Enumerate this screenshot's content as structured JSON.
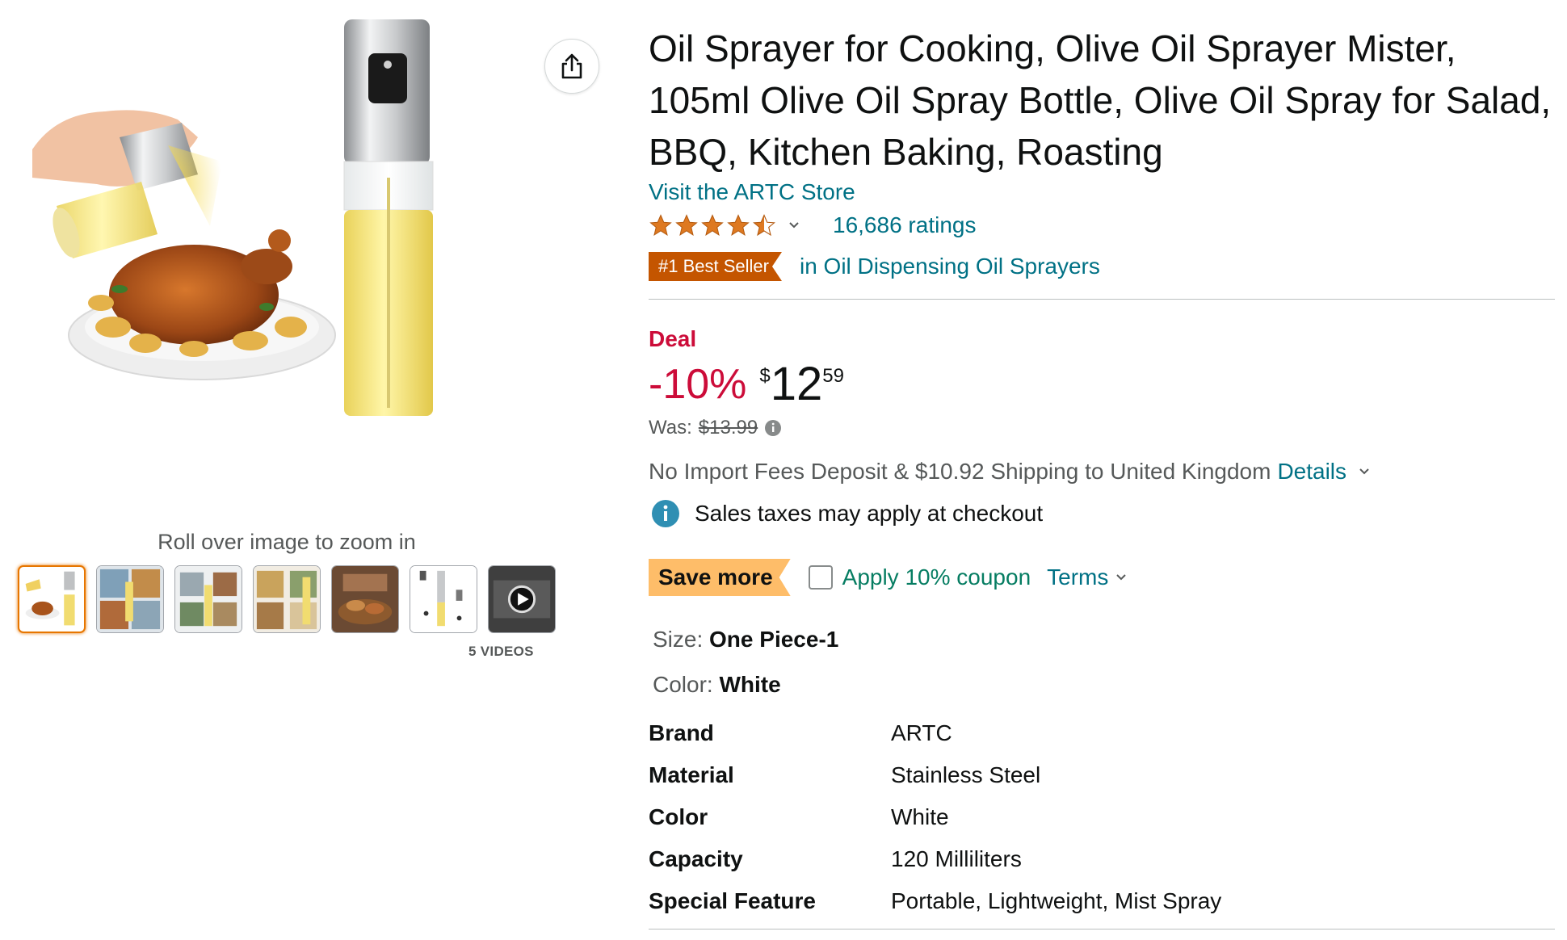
{
  "gallery": {
    "zoom_hint": "Roll over image to zoom in",
    "thumbnails": [
      {
        "label": "thumbnail-1",
        "selected": true
      },
      {
        "label": "thumbnail-2",
        "selected": false
      },
      {
        "label": "thumbnail-3",
        "selected": false
      },
      {
        "label": "thumbnail-4",
        "selected": false
      },
      {
        "label": "thumbnail-5",
        "selected": false
      },
      {
        "label": "thumbnail-6",
        "selected": false
      },
      {
        "label": "video-thumbnail",
        "selected": false
      }
    ],
    "videos_label": "5 VIDEOS"
  },
  "product": {
    "title": "Oil Sprayer for Cooking, Olive Oil Sprayer Mister, 105ml Olive Oil Spray Bottle, Olive Oil Spray for Salad, BBQ, Kitchen Baking, Roasting",
    "store_link": "Visit the ARTC Store",
    "rating": 4.5,
    "ratings_count": "16,686 ratings",
    "bestseller_badge": "#1 Best Seller",
    "bestseller_category": "in Oil Dispensing Oil Sprayers"
  },
  "pricing": {
    "deal_label": "Deal",
    "discount": "-10%",
    "currency": "$",
    "price_whole": "12",
    "price_fraction": "59",
    "was_label": "Was:",
    "was_price": "$13.99",
    "shipping_text": "No Import Fees Deposit & $10.92 Shipping to United Kingdom",
    "details_link": "Details",
    "tax_note": "Sales taxes may apply at checkout"
  },
  "coupon": {
    "badge": "Save more",
    "checkbox_label": "Apply 10% coupon",
    "checked": false,
    "terms_link": "Terms"
  },
  "variations": {
    "size_label": "Size:",
    "size_value": "One Piece-1",
    "color_label": "Color:",
    "color_value": "White"
  },
  "specs": [
    {
      "key": "Brand",
      "value": "ARTC"
    },
    {
      "key": "Material",
      "value": "Stainless Steel"
    },
    {
      "key": "Color",
      "value": "White"
    },
    {
      "key": "Capacity",
      "value": "120 Milliliters"
    },
    {
      "key": "Special Feature",
      "value": "Portable, Lightweight, Mist Spray"
    }
  ],
  "colors": {
    "link": "#007185",
    "deal_red": "#cc0c39",
    "badge_orange": "#c45500",
    "save_orange": "#febd69",
    "coupon_green": "#067d62",
    "star": "#de7921",
    "thumb_selected": "#e77600"
  },
  "icons": {
    "share": "share-icon",
    "info": "info-icon",
    "chevron": "chevron-down-icon",
    "play": "play-icon"
  }
}
